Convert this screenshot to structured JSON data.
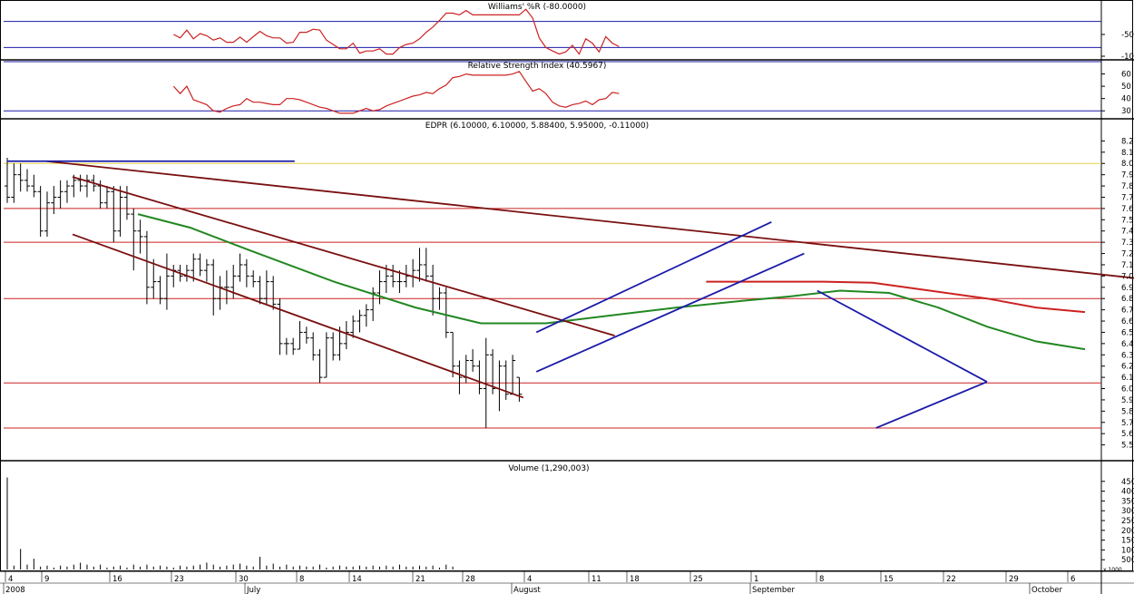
{
  "chart_data": {
    "type": "line",
    "x_axis": {
      "day_labels": [
        "4",
        "9",
        "16",
        "23",
        "30",
        "8",
        "14",
        "21",
        "28",
        "4",
        "11",
        "18",
        "25",
        "1",
        "8",
        "15",
        "22",
        "29",
        "6"
      ],
      "month_labels": [
        "2008",
        "July",
        "August",
        "September",
        "October"
      ]
    },
    "panels": [
      {
        "id": "williams",
        "title": "Williams' %R (-80.0000)",
        "ylim": [
          -100,
          0
        ],
        "y_ticks": [
          "-50",
          "-100"
        ],
        "levels": [
          -20,
          -80
        ],
        "series": [
          {
            "color": "#cc2222",
            "values": [
              -50,
              -58,
              -40,
              -60,
              -48,
              -53,
              -63,
              -58,
              -68,
              -68,
              -56,
              -68,
              -55,
              -43,
              -53,
              -58,
              -58,
              -70,
              -68,
              -45,
              -45,
              -38,
              -40,
              -63,
              -73,
              -83,
              -83,
              -70,
              -93,
              -88,
              -88,
              -83,
              -95,
              -95,
              -80,
              -73,
              -70,
              -60,
              -45,
              -33,
              -18,
              -1,
              -1,
              -5,
              5,
              -5,
              -5,
              -5,
              -5,
              -5,
              -5,
              -5,
              -5,
              8,
              -12,
              -58,
              -80,
              -88,
              -95,
              -90,
              -75,
              -95,
              -60,
              -70,
              -90,
              -55,
              -70,
              -78
            ]
          }
        ]
      },
      {
        "id": "rsi",
        "title": "Relative Strength Index (40.5967)",
        "ylim": [
          25,
          70
        ],
        "y_ticks": [
          "60",
          "50",
          "40",
          "30"
        ],
        "levels": [
          70,
          30
        ],
        "series": [
          {
            "color": "#cc2222",
            "values": [
              50,
              44,
              50,
              39,
              37,
              35,
              30,
              29,
              32,
              34,
              35,
              40,
              37,
              37,
              36,
              35,
              35,
              40,
              40,
              39,
              37,
              35,
              33,
              32,
              30,
              28,
              28,
              28,
              30,
              32,
              30,
              31,
              34,
              36,
              38,
              40,
              42,
              43,
              45,
              44,
              48,
              51,
              57,
              58,
              60,
              59,
              59,
              59,
              59,
              59,
              59,
              60,
              62,
              54,
              46,
              48,
              44,
              37,
              34,
              33,
              35,
              36,
              38,
              35,
              39,
              40,
              45,
              44
            ]
          }
        ]
      },
      {
        "id": "price",
        "title": "EDPR (6.10000, 6.10000, 5.88400, 5.95000, -0.11000)",
        "ylim": [
          5.4,
          8.3
        ],
        "y_ticks": [
          "8.2",
          "8.1",
          "8.0",
          "7.9",
          "7.8",
          "7.7",
          "7.6",
          "7.5",
          "7.4",
          "7.3",
          "7.2",
          "7.1",
          "7.0",
          "6.9",
          "6.8",
          "6.7",
          "6.6",
          "6.5",
          "6.4",
          "6.3",
          "6.2",
          "6.1",
          "6.0",
          "5.9",
          "5.8",
          "5.7",
          "5.6",
          "5.5"
        ],
        "horizontal_levels": [
          {
            "value": 8.0,
            "color": "#e6d24a"
          },
          {
            "value": 7.6,
            "color": "#cc2222"
          },
          {
            "value": 7.3,
            "color": "#cc2222"
          },
          {
            "value": 6.8,
            "color": "#cc2222"
          },
          {
            "value": 6.05,
            "color": "#cc2222"
          },
          {
            "value": 5.65,
            "color": "#cc2222"
          }
        ],
        "ohlc": [
          [
            7.8,
            8.05,
            7.65,
            7.7
          ],
          [
            7.7,
            8.0,
            7.65,
            7.9
          ],
          [
            7.9,
            8.0,
            7.75,
            7.85
          ],
          [
            7.85,
            7.95,
            7.75,
            7.8
          ],
          [
            7.8,
            7.9,
            7.7,
            7.75
          ],
          [
            7.75,
            7.8,
            7.35,
            7.4
          ],
          [
            7.4,
            7.75,
            7.35,
            7.65
          ],
          [
            7.65,
            7.8,
            7.55,
            7.7
          ],
          [
            7.7,
            7.85,
            7.6,
            7.75
          ],
          [
            7.75,
            7.85,
            7.65,
            7.8
          ],
          [
            7.8,
            7.9,
            7.7,
            7.85
          ],
          [
            7.85,
            7.9,
            7.75,
            7.8
          ],
          [
            7.8,
            7.9,
            7.7,
            7.85
          ],
          [
            7.85,
            7.9,
            7.75,
            7.8
          ],
          [
            7.8,
            7.85,
            7.6,
            7.65
          ],
          [
            7.65,
            7.8,
            7.6,
            7.75
          ],
          [
            7.75,
            7.8,
            7.3,
            7.4
          ],
          [
            7.4,
            7.8,
            7.35,
            7.7
          ],
          [
            7.7,
            7.8,
            7.5,
            7.55
          ],
          [
            7.55,
            7.6,
            7.05,
            7.4
          ],
          [
            7.4,
            7.5,
            7.2,
            7.35
          ],
          [
            7.35,
            7.4,
            6.75,
            6.9
          ],
          [
            6.9,
            7.15,
            6.8,
            6.95
          ],
          [
            6.95,
            7.0,
            6.75,
            6.8
          ],
          [
            6.8,
            7.2,
            6.7,
            7.0
          ],
          [
            7.0,
            7.1,
            6.9,
            7.05
          ],
          [
            7.05,
            7.1,
            6.95,
            7.0
          ],
          [
            7.0,
            7.1,
            6.95,
            7.05
          ],
          [
            7.05,
            7.2,
            6.95,
            7.15
          ],
          [
            7.15,
            7.2,
            7.0,
            7.05
          ],
          [
            7.05,
            7.15,
            6.95,
            7.1
          ],
          [
            7.1,
            7.15,
            6.65,
            6.8
          ],
          [
            6.8,
            7.0,
            6.7,
            6.9
          ],
          [
            6.9,
            7.05,
            6.75,
            6.9
          ],
          [
            6.9,
            7.1,
            6.8,
            7.0
          ],
          [
            7.0,
            7.2,
            6.95,
            7.1
          ],
          [
            7.1,
            7.15,
            6.9,
            7.0
          ],
          [
            7.0,
            7.05,
            6.9,
            6.95
          ],
          [
            6.95,
            7.0,
            6.75,
            6.8
          ],
          [
            6.8,
            7.05,
            6.75,
            6.95
          ],
          [
            6.95,
            7.0,
            6.7,
            6.75
          ],
          [
            6.75,
            6.8,
            6.3,
            6.4
          ],
          [
            6.4,
            6.45,
            6.3,
            6.4
          ],
          [
            6.4,
            6.45,
            6.3,
            6.35
          ],
          [
            6.35,
            6.6,
            6.35,
            6.5
          ],
          [
            6.5,
            6.55,
            6.4,
            6.45
          ],
          [
            6.45,
            6.5,
            6.25,
            6.3
          ],
          [
            6.3,
            6.35,
            6.05,
            6.1
          ],
          [
            6.1,
            6.5,
            6.1,
            6.45
          ],
          [
            6.45,
            6.5,
            6.25,
            6.3
          ],
          [
            6.3,
            6.55,
            6.25,
            6.4
          ],
          [
            6.4,
            6.6,
            6.35,
            6.5
          ],
          [
            6.5,
            6.65,
            6.45,
            6.6
          ],
          [
            6.6,
            6.7,
            6.5,
            6.65
          ],
          [
            6.65,
            6.75,
            6.55,
            6.7
          ],
          [
            6.7,
            6.9,
            6.6,
            6.85
          ],
          [
            6.85,
            7.05,
            6.75,
            6.95
          ],
          [
            6.95,
            7.1,
            6.85,
            7.0
          ],
          [
            7.0,
            7.1,
            6.9,
            6.95
          ],
          [
            6.95,
            7.05,
            6.85,
            6.95
          ],
          [
            6.95,
            7.1,
            6.9,
            7.0
          ],
          [
            7.0,
            7.15,
            6.9,
            7.05
          ],
          [
            7.05,
            7.25,
            6.95,
            7.1
          ],
          [
            7.1,
            7.25,
            6.95,
            7.0
          ],
          [
            7.0,
            7.1,
            6.65,
            6.8
          ],
          [
            6.8,
            6.9,
            6.7,
            6.85
          ],
          [
            6.85,
            6.9,
            6.45,
            6.5
          ],
          [
            6.5,
            6.5,
            6.1,
            6.2
          ],
          [
            6.2,
            6.25,
            5.95,
            6.1
          ],
          [
            6.1,
            6.3,
            6.05,
            6.25
          ],
          [
            6.25,
            6.35,
            6.15,
            6.2
          ],
          [
            6.2,
            6.25,
            5.95,
            6.0
          ],
          [
            6.0,
            6.45,
            5.65,
            6.3
          ],
          [
            6.3,
            6.35,
            5.95,
            6.0
          ],
          [
            6.0,
            6.25,
            5.8,
            6.2
          ],
          [
            6.2,
            6.25,
            5.9,
            5.95
          ],
          [
            5.95,
            6.3,
            5.95,
            6.25
          ],
          [
            6.1,
            6.1,
            5.884,
            5.95
          ]
        ],
        "moving_averages": [
          {
            "color": "#228822",
            "points": [
              [
                40,
                7.55
              ],
              [
                56,
                7.43
              ],
              [
                75,
                7.22
              ],
              [
                100,
                6.95
              ],
              [
                125,
                6.72
              ],
              [
                145,
                6.58
              ],
              [
                165,
                6.58
              ],
              [
                185,
                6.65
              ],
              [
                205,
                6.72
              ],
              [
                225,
                6.78
              ],
              [
                240,
                6.82
              ],
              [
                255,
                6.87
              ],
              [
                270,
                6.85
              ],
              [
                285,
                6.72
              ],
              [
                300,
                6.55
              ],
              [
                315,
                6.42
              ],
              [
                330,
                6.35
              ]
            ]
          },
          {
            "color": "#cc2222",
            "points": [
              [
                214,
                6.95
              ],
              [
                230,
                6.95
              ],
              [
                250,
                6.95
              ],
              [
                265,
                6.94
              ],
              [
                280,
                6.88
              ],
              [
                300,
                6.8
              ],
              [
                315,
                6.72
              ],
              [
                330,
                6.68
              ]
            ]
          }
        ],
        "trendlines": [
          {
            "color": "#7a1010",
            "points": [
              [
                12,
                8.02
              ],
              [
                365,
                6.92
              ]
            ]
          },
          {
            "color": "#7a1010",
            "points": [
              [
                20,
                7.88
              ],
              [
                186,
                6.47
              ]
            ]
          },
          {
            "color": "#7a1010",
            "points": [
              [
                20,
                7.37
              ],
              [
                158,
                5.92
              ]
            ]
          },
          {
            "color": "#1a1aa8",
            "points": [
              [
                162,
                6.5
              ],
              [
                234,
                7.48
              ]
            ]
          },
          {
            "color": "#1a1aa8",
            "points": [
              [
                162,
                6.15
              ],
              [
                244,
                7.2
              ]
            ]
          },
          {
            "color": "#1a1aa8",
            "points": [
              [
                248,
                6.87
              ],
              [
                300,
                6.06
              ]
            ]
          },
          {
            "color": "#1a1aa8",
            "points": [
              [
                266,
                5.65
              ],
              [
                300,
                6.06
              ]
            ]
          },
          {
            "color": "#1a1aa8",
            "points": [
              [
                0,
                8.02
              ],
              [
                88,
                8.02
              ]
            ]
          }
        ]
      },
      {
        "id": "volume",
        "title": "Volume (1,290,003)",
        "ylim": [
          0,
          50000
        ],
        "y_ticks": [
          "45000",
          "40000",
          "35000",
          "30000",
          "25000",
          "20000",
          "15000",
          "10000",
          "5000"
        ],
        "x_bottom_label": "x 1000",
        "values": [
          47000,
          2000,
          10500,
          2500,
          5500,
          1500,
          2000,
          1000,
          2000,
          1500,
          2500,
          3500,
          2500,
          1500,
          2500,
          1000,
          1500,
          2000,
          1000,
          2500,
          1500,
          2500,
          1500,
          2000,
          1500,
          1000,
          2000,
          1500,
          2000,
          2500,
          3500,
          2500,
          1500,
          2000,
          2500,
          3000,
          2000,
          1500,
          6500,
          2000,
          3000,
          1500,
          2500,
          1500,
          2000,
          1500,
          1500,
          2500,
          1000,
          1500,
          2000,
          1500,
          1500,
          2000,
          1500,
          2000,
          1500,
          2000,
          1500,
          2500,
          1500,
          1500,
          2000,
          1500,
          2000,
          1000,
          2500,
          1500
        ]
      }
    ]
  }
}
